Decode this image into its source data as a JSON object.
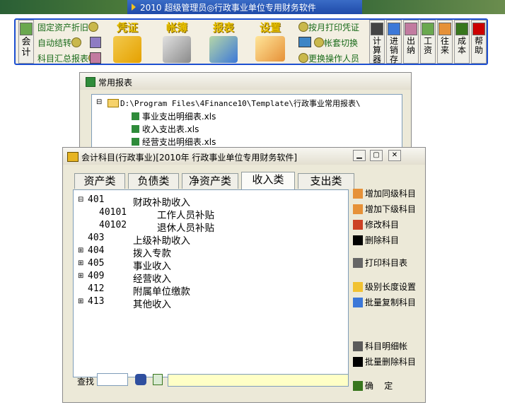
{
  "app": {
    "title": "2010  超级管理员◎行政事业单位专用财务软件"
  },
  "toolbar": {
    "left_button_label": "会\n计",
    "left_links": [
      "固定资产折旧",
      "自动结转",
      "科目汇总报表"
    ],
    "big_buttons": [
      "凭证",
      "帐簿",
      "报表",
      "设置"
    ],
    "right_links": [
      "按月打印凭证",
      "帐套切换",
      "更换操作人员"
    ],
    "small_buttons": [
      "计算器",
      "进销存",
      "出纳",
      "工资",
      "往来",
      "成本",
      "帮助"
    ]
  },
  "report_window": {
    "title": "常用报表",
    "path": "D:\\Program Files\\4Finance10\\Template\\行政事业常用报表\\",
    "files": [
      "事业支出明细表.xls",
      "收入支出表.xls",
      "经营支出明细表.xls"
    ]
  },
  "account_window": {
    "title": "会计科目(行政事业)[2010年 行政事业单位专用财务软件]",
    "tabs": [
      "资产类",
      "负债类",
      "净资产类",
      "收入类",
      "支出类"
    ],
    "active_tab": "收入类",
    "tree": [
      {
        "code": "401",
        "name": "财政补助收入",
        "expander": "⊟"
      },
      {
        "code": "40101",
        "name": "工作人员补贴",
        "expander": ""
      },
      {
        "code": "40102",
        "name": "退休人员补贴",
        "expander": ""
      },
      {
        "code": "403",
        "name": "上级补助收入",
        "expander": ""
      },
      {
        "code": "404",
        "name": "拨入专款",
        "expander": "⊞"
      },
      {
        "code": "405",
        "name": "事业收入",
        "expander": "⊞"
      },
      {
        "code": "409",
        "name": "经营收入",
        "expander": "⊞"
      },
      {
        "code": "412",
        "name": "附属单位缴款",
        "expander": ""
      },
      {
        "code": "413",
        "name": "其他收入",
        "expander": "⊞"
      }
    ],
    "buttons": [
      "增加同级科目",
      "增加下级科目",
      "修改科目",
      "删除科目",
      "打印科目表",
      "级别长度设置",
      "批量复制科目",
      "科目明细帐",
      "批量删除科目",
      "确    定"
    ],
    "search_label": "查找",
    "search_value": ""
  },
  "colors": {
    "toolbar_border": "#1d4fd1",
    "window_bg": "#ece9d8",
    "big_label": "#e8c100",
    "link_green": "#1a6b1a",
    "search_yellow": "#ffffc6"
  }
}
